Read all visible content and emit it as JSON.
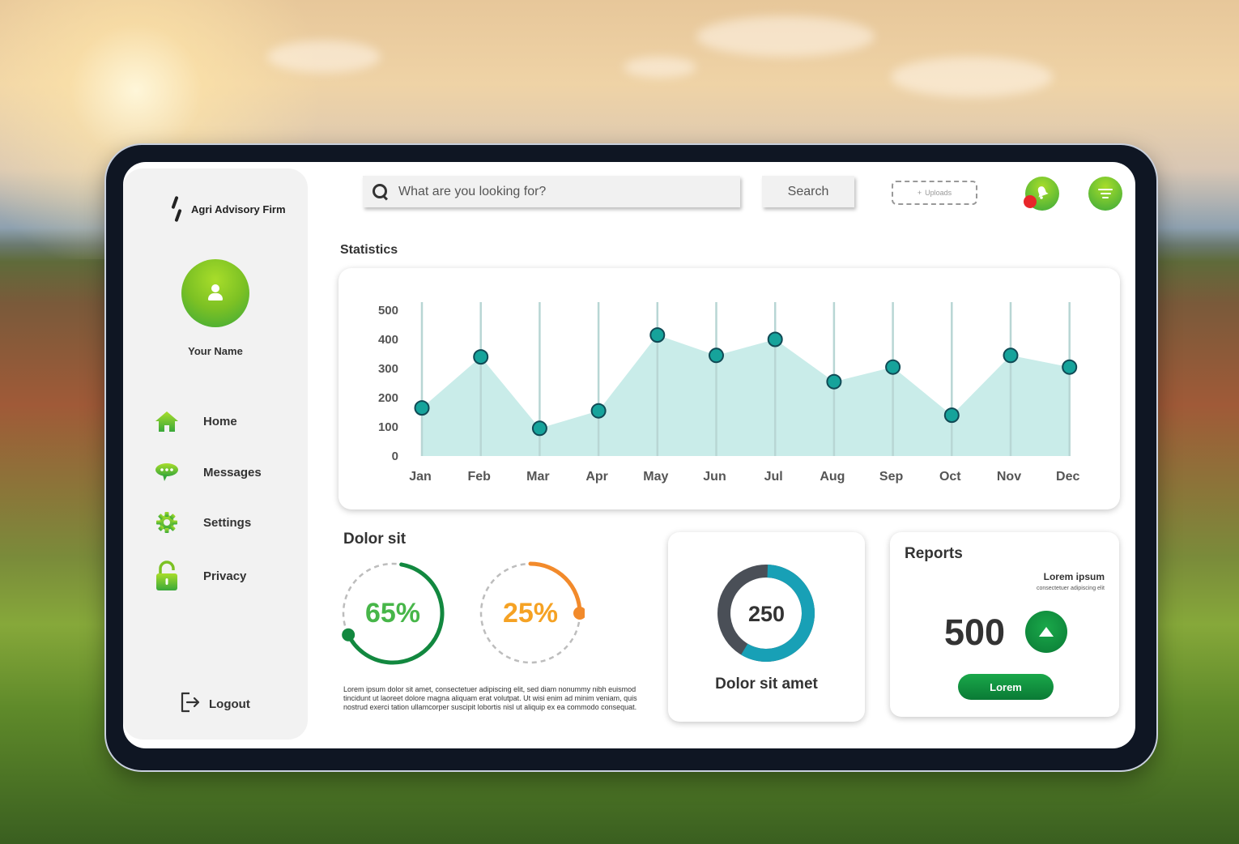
{
  "brand": {
    "name": "Agri Advisory Firm"
  },
  "profile": {
    "name": "Your Name"
  },
  "nav": {
    "items": [
      {
        "label": "Home",
        "icon": "home-icon"
      },
      {
        "label": "Messages",
        "icon": "chat-icon"
      },
      {
        "label": "Settings",
        "icon": "gear-icon"
      },
      {
        "label": "Privacy",
        "icon": "lock-icon"
      }
    ],
    "logout": "Logout"
  },
  "header": {
    "search_placeholder": "What are you looking for?",
    "search_button": "Search",
    "uploads_label": "Uploads"
  },
  "statistics": {
    "title": "Statistics"
  },
  "chart_data": {
    "type": "area",
    "categories": [
      "Jan",
      "Feb",
      "Mar",
      "Apr",
      "May",
      "Jun",
      "Jul",
      "Aug",
      "Sep",
      "Oct",
      "Nov",
      "Dec"
    ],
    "values": [
      165,
      340,
      95,
      155,
      415,
      345,
      400,
      255,
      305,
      140,
      345,
      305
    ],
    "ylim": [
      0,
      500
    ],
    "yticks": [
      0,
      100,
      200,
      300,
      400,
      500
    ],
    "grid": "vertical",
    "colors": {
      "fill": "#c9ece9",
      "line": "#b8d6d4",
      "marker": "#16a39b",
      "marker_stroke": "#114a55"
    }
  },
  "dolor_sit": {
    "title": "Dolor sit",
    "rings": [
      {
        "percent": 65,
        "label": "65%",
        "color": "#12883f",
        "text_color": "#47b649"
      },
      {
        "percent": 25,
        "label": "25%",
        "color": "#f28a2b",
        "text_color": "#f5a224"
      }
    ],
    "text": "Lorem ipsum dolor sit amet, consectetuer adipiscing elit, sed diam nonummy nibh euismod tincidunt ut laoreet dolore magna aliquam erat volutpat. Ut wisi enim ad minim veniam, quis nostrud exerci tation ullamcorper suscipit lobortis nisl ut aliquip ex ea commodo consequat."
  },
  "donut": {
    "value": "250",
    "label": "Dolor sit amet",
    "share": 0.58,
    "colors": {
      "primary": "#18a0b6",
      "secondary": "#4a4f57"
    }
  },
  "reports": {
    "title": "Reports",
    "subtitle": "Lorem ipsum",
    "caption": "consectetuer adipiscing elit",
    "value": "500",
    "button": "Lorem"
  }
}
